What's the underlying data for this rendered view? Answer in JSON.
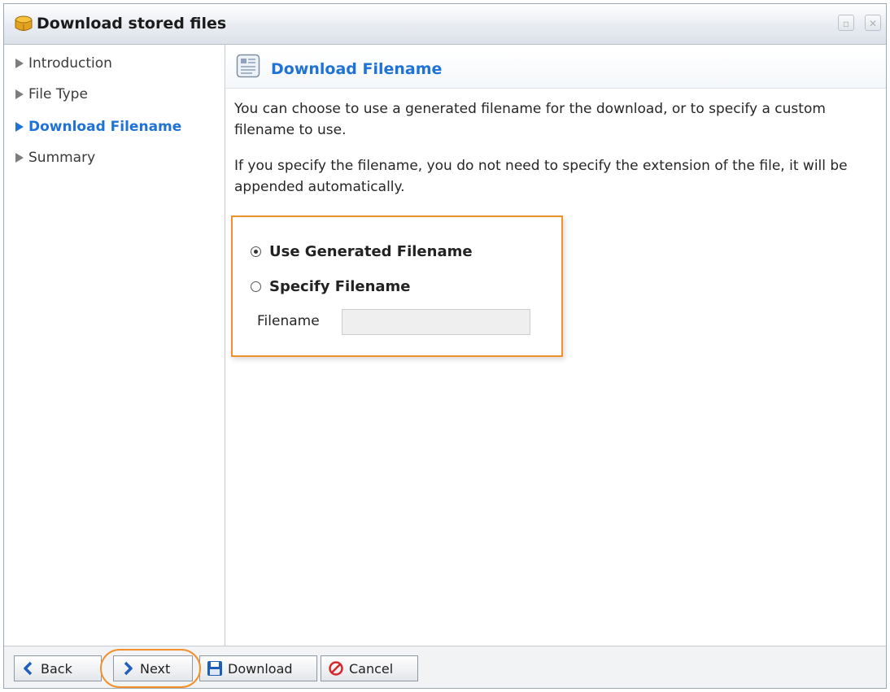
{
  "window": {
    "title": "Download stored files",
    "minimize_glyph": "▫",
    "close_glyph": "✕"
  },
  "sidebar": {
    "items": [
      {
        "label": "Introduction",
        "active": false
      },
      {
        "label": "File Type",
        "active": false
      },
      {
        "label": "Download Filename",
        "active": true
      },
      {
        "label": "Summary",
        "active": false
      }
    ]
  },
  "main": {
    "title": "Download Filename",
    "paragraph1": "You can choose to use a generated filename for the download, or to specify a custom filename to use.",
    "paragraph2": "If you specify the filename, you do not need to specify the extension of the file, it will be appended automatically.",
    "options": {
      "generated_label": "Use Generated Filename",
      "generated_checked": true,
      "specify_label": "Specify Filename",
      "specify_checked": false
    },
    "filename_label": "Filename",
    "filename_value": ""
  },
  "footer": {
    "back_label": "Back",
    "next_label": "Next",
    "download_label": "Download",
    "cancel_label": "Cancel"
  },
  "colors": {
    "accent": "#1f73d6",
    "highlight": "#f2902c",
    "cancel_red": "#d8262a",
    "download_blue": "#1d5fb8"
  },
  "icons": {
    "title": "gold-cube-icon",
    "section": "document-icon",
    "back": "chevron-left-icon",
    "next": "chevron-right-icon",
    "download": "save-disk-icon",
    "cancel": "no-entry-icon"
  }
}
